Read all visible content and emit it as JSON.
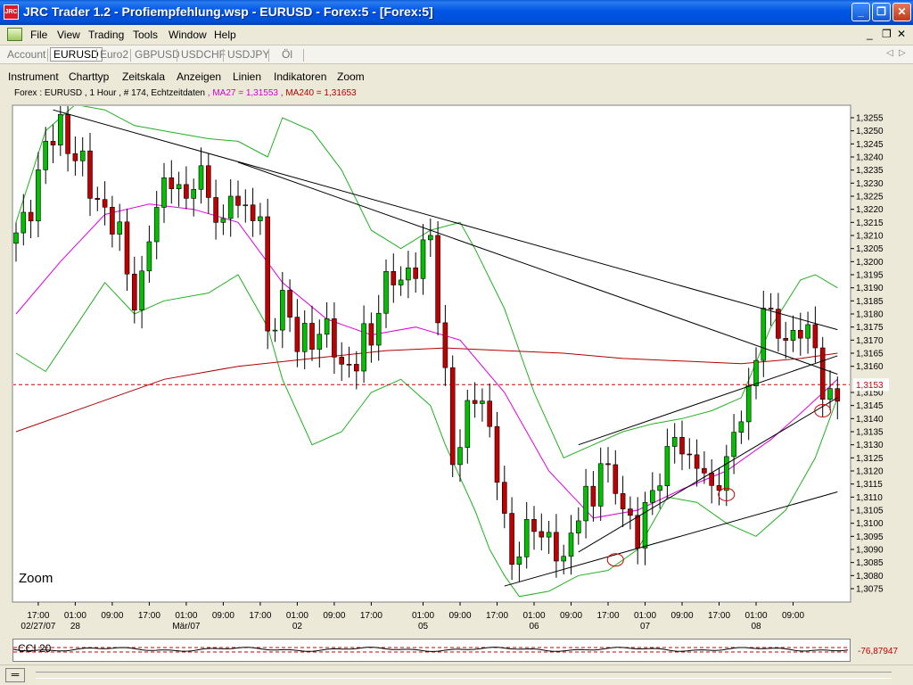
{
  "window": {
    "title": "JRC Trader 1.2 - Profiempfehlung.wsp - EURUSD - Forex:5 - [Forex:5]",
    "icon_label": "JRC",
    "controls": [
      "minimize-icon",
      "restore-icon",
      "close-icon"
    ]
  },
  "menubar": {
    "items": [
      "File",
      "View",
      "Trading",
      "Tools",
      "Window",
      "Help"
    ]
  },
  "symbolbar": {
    "account": "Account",
    "tabs": [
      "EURUSD",
      "Euro2",
      "GBPUSD",
      "USDCHF",
      "USDJPY",
      "Öl"
    ],
    "active": "EURUSD"
  },
  "chartmenu": {
    "items": [
      "Instrument",
      "Charttyp",
      "Zeitskala",
      "Anzeigen",
      "Linien",
      "Indikatoren",
      "Zoom"
    ]
  },
  "chart_info": {
    "main": "Forex : EURUSD , 1 Hour , # 174, Echtzeitdaten",
    "ma27": ", MA27 = 1,31553",
    "ma240": ", MA240 = 1,31653"
  },
  "zoom_label": "Zoom",
  "indicator": {
    "name": "CCI 20",
    "value_label": "-76,87947"
  },
  "chart_data": {
    "type": "candlestick",
    "instrument": "EURUSD",
    "timeframe": "1 Hour",
    "ylim": [
      1.307,
      1.326
    ],
    "y_ticks": [
      "1,3255",
      "1,3250",
      "1,3245",
      "1,3240",
      "1,3235",
      "1,3230",
      "1,3225",
      "1,3220",
      "1,3215",
      "1,3210",
      "1,3205",
      "1,3200",
      "1,3195",
      "1,3190",
      "1,3185",
      "1,3180",
      "1,3175",
      "1,3170",
      "1,3165",
      "1,3160",
      "1,3155",
      "1,3150",
      "1,3145",
      "1,3140",
      "1,3135",
      "1,3130",
      "1,3125",
      "1,3120",
      "1,3115",
      "1,3110",
      "1,3105",
      "1,3100",
      "1,3095",
      "1,3090",
      "1,3085",
      "1,3080",
      "1,3075"
    ],
    "hidden_tick": "1,3155",
    "current_price": 1.3153,
    "current_price_label": "1,3153",
    "x_ticks": [
      {
        "i": 3,
        "time": "17:00",
        "date": "02/27/07"
      },
      {
        "i": 8,
        "time": "01:00",
        "date": "28"
      },
      {
        "i": 13,
        "time": "09:00",
        "date": ""
      },
      {
        "i": 18,
        "time": "17:00",
        "date": ""
      },
      {
        "i": 23,
        "time": "01:00",
        "date": "Mär/07"
      },
      {
        "i": 28,
        "time": "09:00",
        "date": ""
      },
      {
        "i": 33,
        "time": "17:00",
        "date": ""
      },
      {
        "i": 38,
        "time": "01:00",
        "date": "02"
      },
      {
        "i": 43,
        "time": "09:00",
        "date": ""
      },
      {
        "i": 48,
        "time": "17:00",
        "date": ""
      },
      {
        "i": 55,
        "time": "01:00",
        "date": "05"
      },
      {
        "i": 60,
        "time": "09:00",
        "date": ""
      },
      {
        "i": 65,
        "time": "17:00",
        "date": ""
      },
      {
        "i": 70,
        "time": "01:00",
        "date": "06"
      },
      {
        "i": 75,
        "time": "09:00",
        "date": ""
      },
      {
        "i": 80,
        "time": "17:00",
        "date": ""
      },
      {
        "i": 85,
        "time": "01:00",
        "date": "07"
      },
      {
        "i": 90,
        "time": "09:00",
        "date": ""
      },
      {
        "i": 95,
        "time": "17:00",
        "date": ""
      },
      {
        "i": 100,
        "time": "01:00",
        "date": "08"
      },
      {
        "i": 105,
        "time": "09:00",
        "date": ""
      }
    ],
    "close_path": [
      [
        0,
        1.3211
      ],
      [
        2,
        1.322
      ],
      [
        4,
        1.3245
      ],
      [
        6,
        1.3252
      ],
      [
        7,
        1.3243
      ],
      [
        9,
        1.3238
      ],
      [
        10,
        1.3228
      ],
      [
        12,
        1.3218
      ],
      [
        14,
        1.3212
      ],
      [
        15,
        1.3195
      ],
      [
        16,
        1.3185
      ],
      [
        17,
        1.3192
      ],
      [
        18,
        1.321
      ],
      [
        19,
        1.3222
      ],
      [
        20,
        1.3228
      ],
      [
        21,
        1.3232
      ],
      [
        22,
        1.3228
      ],
      [
        23,
        1.3222
      ],
      [
        24,
        1.3232
      ],
      [
        25,
        1.3233
      ],
      [
        26,
        1.3225
      ],
      [
        27,
        1.3218
      ],
      [
        28,
        1.3212
      ],
      [
        29,
        1.3228
      ],
      [
        30,
        1.3222
      ],
      [
        31,
        1.3218
      ],
      [
        32,
        1.322
      ],
      [
        33,
        1.3215
      ],
      [
        34,
        1.3172
      ],
      [
        35,
        1.3178
      ],
      [
        36,
        1.3185
      ],
      [
        37,
        1.318
      ],
      [
        38,
        1.3168
      ],
      [
        39,
        1.3172
      ],
      [
        40,
        1.317
      ],
      [
        41,
        1.3172
      ],
      [
        42,
        1.3175
      ],
      [
        43,
        1.3168
      ],
      [
        44,
        1.3158
      ],
      [
        45,
        1.316
      ],
      [
        46,
        1.3162
      ],
      [
        47,
        1.3172
      ],
      [
        48,
        1.317
      ],
      [
        49,
        1.3182
      ],
      [
        50,
        1.3192
      ],
      [
        51,
        1.3195
      ],
      [
        52,
        1.3192
      ],
      [
        53,
        1.3195
      ],
      [
        54,
        1.3198
      ],
      [
        55,
        1.3205
      ],
      [
        56,
        1.321
      ],
      [
        57,
        1.318
      ],
      [
        58,
        1.3155
      ],
      [
        59,
        1.3125
      ],
      [
        60,
        1.313
      ],
      [
        61,
        1.3143
      ],
      [
        62,
        1.315
      ],
      [
        63,
        1.3145
      ],
      [
        64,
        1.3135
      ],
      [
        65,
        1.312
      ],
      [
        66,
        1.31
      ],
      [
        67,
        1.3085
      ],
      [
        68,
        1.309
      ],
      [
        69,
        1.3097
      ],
      [
        70,
        1.31
      ],
      [
        71,
        1.3095
      ],
      [
        72,
        1.3093
      ],
      [
        73,
        1.309
      ],
      [
        74,
        1.3085
      ],
      [
        75,
        1.3095
      ],
      [
        76,
        1.3105
      ],
      [
        77,
        1.311
      ],
      [
        78,
        1.3108
      ],
      [
        79,
        1.3125
      ],
      [
        80,
        1.3118
      ],
      [
        81,
        1.3115
      ],
      [
        82,
        1.3105
      ],
      [
        83,
        1.31
      ],
      [
        84,
        1.3095
      ],
      [
        85,
        1.3105
      ],
      [
        86,
        1.3112
      ],
      [
        87,
        1.3118
      ],
      [
        88,
        1.3125
      ],
      [
        89,
        1.3135
      ],
      [
        90,
        1.3128
      ],
      [
        91,
        1.3122
      ],
      [
        92,
        1.3125
      ],
      [
        93,
        1.3118
      ],
      [
        94,
        1.3112
      ],
      [
        95,
        1.3117
      ],
      [
        96,
        1.3122
      ],
      [
        97,
        1.3135
      ],
      [
        98,
        1.3142
      ],
      [
        99,
        1.3148
      ],
      [
        100,
        1.3165
      ],
      [
        101,
        1.3183
      ],
      [
        102,
        1.3178
      ],
      [
        103,
        1.3175
      ],
      [
        104,
        1.3168
      ],
      [
        105,
        1.3172
      ],
      [
        106,
        1.3175
      ],
      [
        107,
        1.3172
      ],
      [
        108,
        1.3168
      ],
      [
        109,
        1.315
      ],
      [
        110,
        1.3147
      ],
      [
        111,
        1.315
      ]
    ],
    "ma27": [
      [
        0,
        1.318
      ],
      [
        6,
        1.32
      ],
      [
        12,
        1.3218
      ],
      [
        18,
        1.3222
      ],
      [
        24,
        1.322
      ],
      [
        30,
        1.3215
      ],
      [
        36,
        1.3192
      ],
      [
        42,
        1.3178
      ],
      [
        48,
        1.3172
      ],
      [
        54,
        1.3175
      ],
      [
        60,
        1.317
      ],
      [
        66,
        1.315
      ],
      [
        72,
        1.312
      ],
      [
        78,
        1.3102
      ],
      [
        84,
        1.3105
      ],
      [
        90,
        1.3113
      ],
      [
        96,
        1.312
      ],
      [
        102,
        1.3132
      ],
      [
        106,
        1.3142
      ],
      [
        111,
        1.3155
      ]
    ],
    "ma240": [
      [
        0,
        1.3135
      ],
      [
        10,
        1.3145
      ],
      [
        20,
        1.3155
      ],
      [
        30,
        1.316
      ],
      [
        40,
        1.3163
      ],
      [
        50,
        1.3166
      ],
      [
        58,
        1.3167
      ],
      [
        66,
        1.3166
      ],
      [
        74,
        1.3165
      ],
      [
        82,
        1.3163
      ],
      [
        90,
        1.3162
      ],
      [
        98,
        1.3161
      ],
      [
        106,
        1.3163
      ],
      [
        111,
        1.3165
      ]
    ],
    "boll_upper": [
      [
        0,
        1.3215
      ],
      [
        4,
        1.325
      ],
      [
        8,
        1.326
      ],
      [
        12,
        1.3258
      ],
      [
        16,
        1.3252
      ],
      [
        20,
        1.325
      ],
      [
        26,
        1.3247
      ],
      [
        30,
        1.3246
      ],
      [
        34,
        1.324
      ],
      [
        36,
        1.3255
      ],
      [
        40,
        1.325
      ],
      [
        44,
        1.3235
      ],
      [
        48,
        1.3212
      ],
      [
        52,
        1.3205
      ],
      [
        56,
        1.3212
      ],
      [
        60,
        1.3215
      ],
      [
        62,
        1.3205
      ],
      [
        66,
        1.3182
      ],
      [
        70,
        1.315
      ],
      [
        74,
        1.3125
      ],
      [
        78,
        1.313
      ],
      [
        82,
        1.3135
      ],
      [
        86,
        1.3138
      ],
      [
        90,
        1.314
      ],
      [
        94,
        1.3143
      ],
      [
        98,
        1.3148
      ],
      [
        102,
        1.3175
      ],
      [
        106,
        1.3193
      ],
      [
        108,
        1.3195
      ],
      [
        111,
        1.319
      ]
    ],
    "boll_lower": [
      [
        0,
        1.3165
      ],
      [
        4,
        1.3158
      ],
      [
        8,
        1.3175
      ],
      [
        12,
        1.3192
      ],
      [
        16,
        1.318
      ],
      [
        20,
        1.3185
      ],
      [
        26,
        1.3188
      ],
      [
        30,
        1.3195
      ],
      [
        34,
        1.3175
      ],
      [
        36,
        1.3155
      ],
      [
        40,
        1.313
      ],
      [
        44,
        1.3135
      ],
      [
        48,
        1.315
      ],
      [
        52,
        1.3155
      ],
      [
        56,
        1.3145
      ],
      [
        58,
        1.313
      ],
      [
        62,
        1.3105
      ],
      [
        64,
        1.309
      ],
      [
        66,
        1.308
      ],
      [
        68,
        1.3072
      ],
      [
        72,
        1.3074
      ],
      [
        76,
        1.308
      ],
      [
        80,
        1.3082
      ],
      [
        84,
        1.309
      ],
      [
        88,
        1.311
      ],
      [
        92,
        1.3108
      ],
      [
        96,
        1.31
      ],
      [
        100,
        1.3095
      ],
      [
        104,
        1.3105
      ],
      [
        108,
        1.3125
      ],
      [
        111,
        1.3148
      ]
    ],
    "trendlines": [
      [
        [
          5,
          1.3258
        ],
        [
          111,
          1.3174
        ]
      ],
      [
        [
          30,
          1.3238
        ],
        [
          111,
          1.3157
        ]
      ],
      [
        [
          66,
          1.3076
        ],
        [
          111,
          1.3112
        ]
      ],
      [
        [
          76,
          1.3089
        ],
        [
          111,
          1.3148
        ]
      ],
      [
        [
          76,
          1.313
        ],
        [
          111,
          1.3164
        ]
      ]
    ],
    "circles": [
      [
        81,
        1.3086
      ],
      [
        96,
        1.3111
      ],
      [
        109,
        1.3143
      ]
    ]
  }
}
